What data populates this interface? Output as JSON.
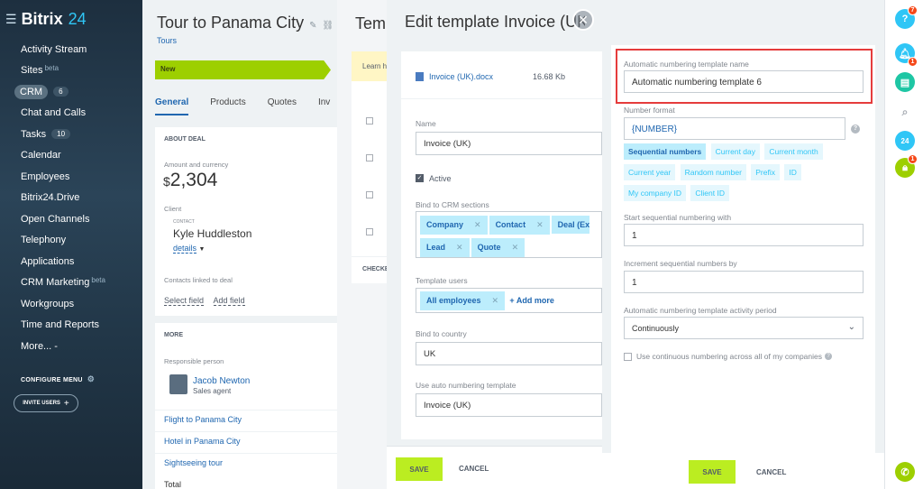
{
  "sidebar": {
    "logo_text": "Bitrix",
    "logo_number": "24",
    "items": [
      {
        "label": "Activity Stream"
      },
      {
        "label": "Sites",
        "sup": "beta"
      },
      {
        "label": "CRM",
        "badge": "6"
      },
      {
        "label": "Chat and Calls"
      },
      {
        "label": "Tasks",
        "badge": "10"
      },
      {
        "label": "Calendar"
      },
      {
        "label": "Employees"
      },
      {
        "label": "Bitrix24.Drive"
      },
      {
        "label": "Open Channels"
      },
      {
        "label": "Telephony"
      },
      {
        "label": "Applications"
      },
      {
        "label": "CRM Marketing",
        "sup": "beta"
      },
      {
        "label": "Workgroups"
      },
      {
        "label": "Time and Reports"
      },
      {
        "label": "More... -"
      }
    ],
    "configure_menu": "CONFIGURE MENU",
    "invite_users": "INVITE USERS"
  },
  "deal": {
    "title": "Tour to Panama City",
    "subtitle": "Tours",
    "stage": "New",
    "tabs": [
      "General",
      "Products",
      "Quotes",
      "Inv"
    ],
    "about_header": "ABOUT DEAL",
    "amount_label": "Amount and currency",
    "amount_currency": "$",
    "amount_value": "2,304",
    "client_label": "Client",
    "contact_tag": "CONTACT",
    "client_name": "Kyle Huddleston",
    "details_link": "details",
    "contacts_linked": "Contacts linked to deal",
    "select_field": "Select field",
    "add_field": "Add field",
    "more_header": "MORE",
    "responsible_label": "Responsible person",
    "responsible_name": "Jacob Newton",
    "responsible_role": "Sales agent",
    "links": [
      "Flight to Panama City",
      "Hotel in Panama City",
      "Sightseeing tour"
    ],
    "total_label": "Total"
  },
  "templates": {
    "title": "Templ",
    "learn": "Learn h",
    "checked_footer": "CHECKE"
  },
  "edit": {
    "title": "Edit template Invoice (UK)",
    "file_name": "Invoice (UK).docx",
    "file_size": "16.68 Kb",
    "name_label": "Name",
    "name_value": "Invoice (UK)",
    "active_label": "Active",
    "bind_crm_label": "Bind to CRM sections",
    "crm_chips": [
      "Company",
      "Contact",
      "Deal (Ex",
      "Lead",
      "Quote"
    ],
    "users_label": "Template users",
    "users_chip": "All employees",
    "add_more": "+ Add more",
    "country_label": "Bind to country",
    "country_value": "UK",
    "auto_label": "Use auto numbering template",
    "auto_value": "Invoice (UK)",
    "save": "SAVE",
    "cancel": "CANCEL"
  },
  "numbering": {
    "name_label": "Automatic numbering template name",
    "name_value": "Automatic numbering template  6",
    "format_label": "Number format",
    "format_value": "{NUMBER}",
    "help_mark": "?",
    "tokens": [
      "Sequential numbers",
      "Current day",
      "Current month",
      "Current year",
      "Random number",
      "Prefix",
      "ID",
      "My company ID",
      "Client ID"
    ],
    "start_label": "Start sequential numbering with",
    "start_value": "1",
    "increment_label": "Increment sequential numbers by",
    "increment_value": "1",
    "period_label": "Automatic numbering template activity period",
    "period_value": "Continuously",
    "continuous_label": "Use continuous numbering across all of my companies",
    "save": "SAVE",
    "cancel": "CANCEL"
  },
  "rail": {
    "help_badge": "7",
    "bell_badge": "1",
    "lock_badge": "1",
    "b24_label": "24"
  },
  "colors": {
    "accent": "#2fc6f6",
    "save_button": "#bbed21",
    "stage_new": "#9dcf00",
    "highlight_box": "#e53c3c"
  }
}
